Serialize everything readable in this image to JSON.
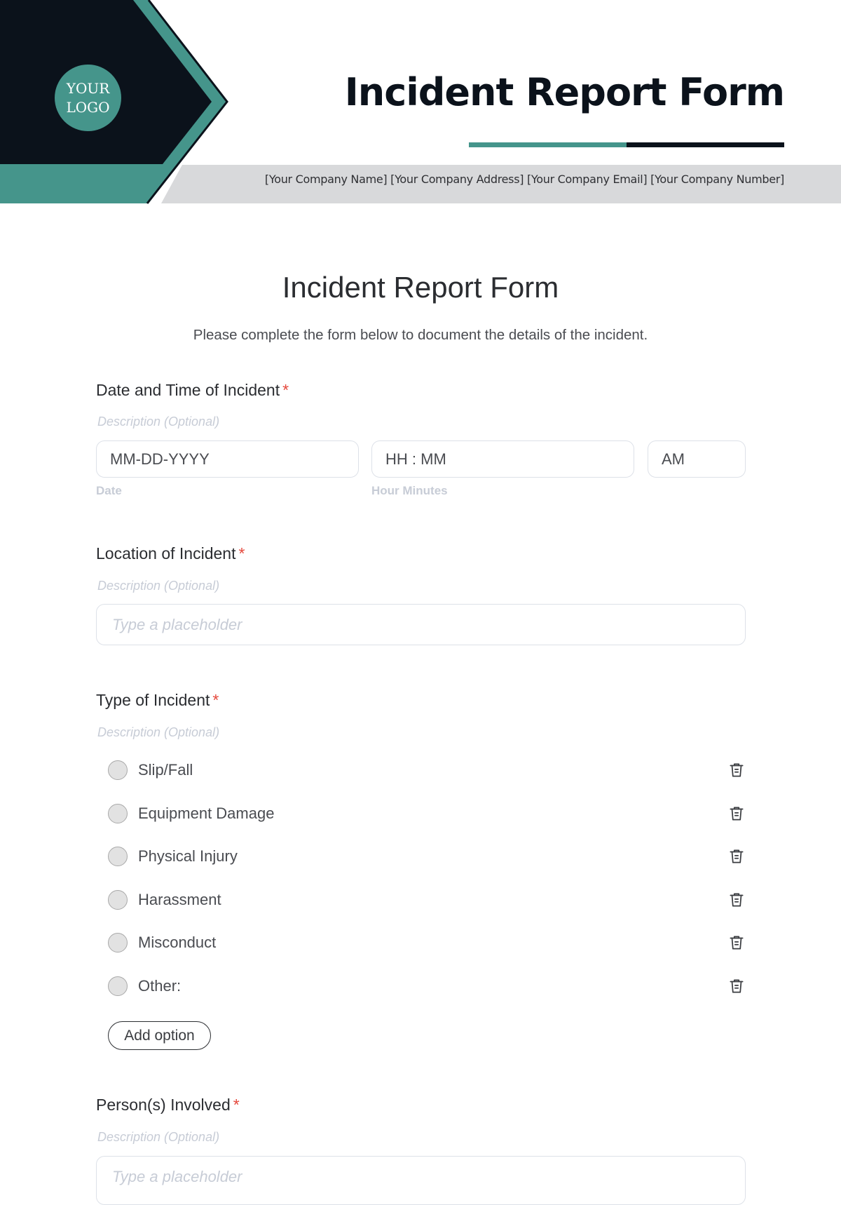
{
  "header": {
    "logo_line1": "YOUR",
    "logo_line2": "LOGO",
    "title": "Incident Report Form",
    "company_info": "[Your Company Name] [Your Company Address] [Your Company Email] [Your Company Number]",
    "colors": {
      "dark": "#0b121b",
      "teal": "#45958b",
      "band": "#d8d9db"
    }
  },
  "form": {
    "title": "Incident Report Form",
    "subtitle": "Please complete the form below to document the details of the incident.",
    "required_mark": "*",
    "questions": [
      {
        "label": "Date and Time of Incident",
        "description": "Description (Optional)",
        "date_placeholder": "MM-DD-YYYY",
        "date_sublabel": "Date",
        "time_placeholder": "HH : MM",
        "time_sublabel": "Hour Minutes",
        "ampm_value": "AM"
      },
      {
        "label": "Location of Incident",
        "description": "Description (Optional)",
        "placeholder": "Type a placeholder"
      },
      {
        "label": "Type of Incident",
        "description": "Description (Optional)",
        "options": [
          {
            "label": "Slip/Fall"
          },
          {
            "label": "Equipment Damage"
          },
          {
            "label": "Physical Injury"
          },
          {
            "label": "Harassment"
          },
          {
            "label": "Misconduct"
          },
          {
            "label": "Other:"
          }
        ],
        "add_option_label": "Add option"
      },
      {
        "label": "Person(s) Involved",
        "description": "Description (Optional)",
        "placeholder": "Type a placeholder"
      }
    ]
  }
}
